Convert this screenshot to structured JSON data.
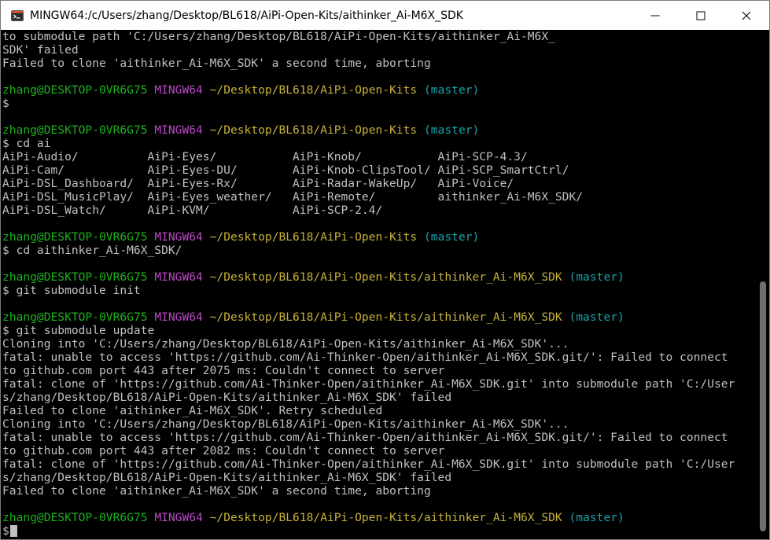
{
  "window": {
    "title": "MINGW64:/c/Users/zhang/Desktop/BL618/AiPi-Open-Kits/aithinker_Ai-M6X_SDK",
    "app_icon": "git-bash-icon",
    "controls": [
      "minimize-icon",
      "maximize-icon",
      "close-icon"
    ]
  },
  "colors": {
    "user_host": "#1db11d",
    "shell": "#b948c6",
    "path": "#c7b13a",
    "branch": "#18a3a8",
    "text": "#c0c0c0",
    "background": "#000000"
  },
  "terminal": {
    "lines": [
      {
        "spans": [
          {
            "t": "to submodule path 'C:/Users/zhang/Desktop/BL618/AiPi-Open-Kits/aithinker_Ai-M6X_",
            "c": "white"
          }
        ]
      },
      {
        "spans": [
          {
            "t": "SDK' failed",
            "c": "white"
          }
        ]
      },
      {
        "spans": [
          {
            "t": "Failed to clone 'aithinker_Ai-M6X_SDK' a second time, aborting",
            "c": "white"
          }
        ]
      },
      {
        "spans": []
      },
      {
        "spans": [
          {
            "t": "zhang@DESKTOP-0VR6G75",
            "c": "green"
          },
          {
            "t": " ",
            "c": "white"
          },
          {
            "t": "MINGW64",
            "c": "magenta"
          },
          {
            "t": " ",
            "c": "white"
          },
          {
            "t": "~/Desktop/BL618/AiPi-Open-Kits",
            "c": "yellow"
          },
          {
            "t": " ",
            "c": "white"
          },
          {
            "t": "(master)",
            "c": "cyan"
          }
        ]
      },
      {
        "spans": [
          {
            "t": "$",
            "c": "white"
          }
        ]
      },
      {
        "spans": []
      },
      {
        "spans": [
          {
            "t": "zhang@DESKTOP-0VR6G75",
            "c": "green"
          },
          {
            "t": " ",
            "c": "white"
          },
          {
            "t": "MINGW64",
            "c": "magenta"
          },
          {
            "t": " ",
            "c": "white"
          },
          {
            "t": "~/Desktop/BL618/AiPi-Open-Kits",
            "c": "yellow"
          },
          {
            "t": " ",
            "c": "white"
          },
          {
            "t": "(master)",
            "c": "cyan"
          }
        ]
      },
      {
        "spans": [
          {
            "t": "$ cd ai",
            "c": "white"
          }
        ]
      },
      {
        "spans": [
          {
            "t": "AiPi-Audio/          AiPi-Eyes/           AiPi-Knob/           AiPi-SCP-4.3/",
            "c": "white"
          }
        ]
      },
      {
        "spans": [
          {
            "t": "AiPi-Cam/            AiPi-Eyes-DU/        AiPi-Knob-ClipsTool/ AiPi-SCP_SmartCtrl/",
            "c": "white"
          }
        ]
      },
      {
        "spans": [
          {
            "t": "AiPi-DSL_Dashboard/  AiPi-Eyes-Rx/        AiPi-Radar-WakeUp/   AiPi-Voice/",
            "c": "white"
          }
        ]
      },
      {
        "spans": [
          {
            "t": "AiPi-DSL_MusicPlay/  AiPi-Eyes_weather/   AiPi-Remote/         aithinker_Ai-M6X_SDK/",
            "c": "white"
          }
        ]
      },
      {
        "spans": [
          {
            "t": "AiPi-DSL_Watch/      AiPi-KVM/            AiPi-SCP-2.4/",
            "c": "white"
          }
        ]
      },
      {
        "spans": []
      },
      {
        "spans": [
          {
            "t": "zhang@DESKTOP-0VR6G75",
            "c": "green"
          },
          {
            "t": " ",
            "c": "white"
          },
          {
            "t": "MINGW64",
            "c": "magenta"
          },
          {
            "t": " ",
            "c": "white"
          },
          {
            "t": "~/Desktop/BL618/AiPi-Open-Kits",
            "c": "yellow"
          },
          {
            "t": " ",
            "c": "white"
          },
          {
            "t": "(master)",
            "c": "cyan"
          }
        ]
      },
      {
        "spans": [
          {
            "t": "$ cd aithinker_Ai-M6X_SDK/",
            "c": "white"
          }
        ]
      },
      {
        "spans": []
      },
      {
        "spans": [
          {
            "t": "zhang@DESKTOP-0VR6G75",
            "c": "green"
          },
          {
            "t": " ",
            "c": "white"
          },
          {
            "t": "MINGW64",
            "c": "magenta"
          },
          {
            "t": " ",
            "c": "white"
          },
          {
            "t": "~/Desktop/BL618/AiPi-Open-Kits/aithinker_Ai-M6X_SDK",
            "c": "yellow"
          },
          {
            "t": " ",
            "c": "white"
          },
          {
            "t": "(master)",
            "c": "cyan"
          }
        ]
      },
      {
        "spans": [
          {
            "t": "$ git submodule init",
            "c": "white"
          }
        ]
      },
      {
        "spans": []
      },
      {
        "spans": [
          {
            "t": "zhang@DESKTOP-0VR6G75",
            "c": "green"
          },
          {
            "t": " ",
            "c": "white"
          },
          {
            "t": "MINGW64",
            "c": "magenta"
          },
          {
            "t": " ",
            "c": "white"
          },
          {
            "t": "~/Desktop/BL618/AiPi-Open-Kits/aithinker_Ai-M6X_SDK",
            "c": "yellow"
          },
          {
            "t": " ",
            "c": "white"
          },
          {
            "t": "(master)",
            "c": "cyan"
          }
        ]
      },
      {
        "spans": [
          {
            "t": "$ git submodule update",
            "c": "white"
          }
        ]
      },
      {
        "spans": [
          {
            "t": "Cloning into 'C:/Users/zhang/Desktop/BL618/AiPi-Open-Kits/aithinker_Ai-M6X_SDK'...",
            "c": "white"
          }
        ]
      },
      {
        "spans": [
          {
            "t": "fatal: unable to access 'https://github.com/Ai-Thinker-Open/aithinker_Ai-M6X_SDK.git/': Failed to connect",
            "c": "white"
          }
        ]
      },
      {
        "spans": [
          {
            "t": "to github.com port 443 after 2075 ms: Couldn't connect to server",
            "c": "white"
          }
        ]
      },
      {
        "spans": [
          {
            "t": "fatal: clone of 'https://github.com/Ai-Thinker-Open/aithinker_Ai-M6X_SDK.git' into submodule path 'C:/User",
            "c": "white"
          }
        ]
      },
      {
        "spans": [
          {
            "t": "s/zhang/Desktop/BL618/AiPi-Open-Kits/aithinker_Ai-M6X_SDK' failed",
            "c": "white"
          }
        ]
      },
      {
        "spans": [
          {
            "t": "Failed to clone 'aithinker_Ai-M6X_SDK'. Retry scheduled",
            "c": "white"
          }
        ]
      },
      {
        "spans": [
          {
            "t": "Cloning into 'C:/Users/zhang/Desktop/BL618/AiPi-Open-Kits/aithinker_Ai-M6X_SDK'...",
            "c": "white"
          }
        ]
      },
      {
        "spans": [
          {
            "t": "fatal: unable to access 'https://github.com/Ai-Thinker-Open/aithinker_Ai-M6X_SDK.git/': Failed to connect",
            "c": "white"
          }
        ]
      },
      {
        "spans": [
          {
            "t": "to github.com port 443 after 2082 ms: Couldn't connect to server",
            "c": "white"
          }
        ]
      },
      {
        "spans": [
          {
            "t": "fatal: clone of 'https://github.com/Ai-Thinker-Open/aithinker_Ai-M6X_SDK.git' into submodule path 'C:/User",
            "c": "white"
          }
        ]
      },
      {
        "spans": [
          {
            "t": "s/zhang/Desktop/BL618/AiPi-Open-Kits/aithinker_Ai-M6X_SDK' failed",
            "c": "white"
          }
        ]
      },
      {
        "spans": [
          {
            "t": "Failed to clone 'aithinker_Ai-M6X_SDK' a second time, aborting",
            "c": "white"
          }
        ]
      },
      {
        "spans": []
      },
      {
        "spans": [
          {
            "t": "zhang@DESKTOP-0VR6G75",
            "c": "green"
          },
          {
            "t": " ",
            "c": "white"
          },
          {
            "t": "MINGW64",
            "c": "magenta"
          },
          {
            "t": " ",
            "c": "white"
          },
          {
            "t": "~/Desktop/BL618/AiPi-Open-Kits/aithinker_Ai-M6X_SDK",
            "c": "yellow"
          },
          {
            "t": " ",
            "c": "white"
          },
          {
            "t": "(master)",
            "c": "cyan"
          }
        ]
      },
      {
        "spans": [
          {
            "t": "$",
            "c": "white"
          }
        ],
        "cursor": true
      }
    ]
  }
}
